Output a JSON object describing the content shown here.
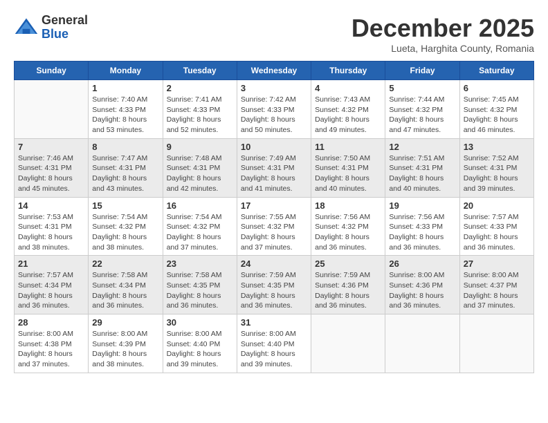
{
  "header": {
    "logo_general": "General",
    "logo_blue": "Blue",
    "month_title": "December 2025",
    "location": "Lueta, Harghita County, Romania"
  },
  "weekdays": [
    "Sunday",
    "Monday",
    "Tuesday",
    "Wednesday",
    "Thursday",
    "Friday",
    "Saturday"
  ],
  "weeks": [
    [
      {
        "day": "",
        "info": ""
      },
      {
        "day": "1",
        "info": "Sunrise: 7:40 AM\nSunset: 4:33 PM\nDaylight: 8 hours\nand 53 minutes."
      },
      {
        "day": "2",
        "info": "Sunrise: 7:41 AM\nSunset: 4:33 PM\nDaylight: 8 hours\nand 52 minutes."
      },
      {
        "day": "3",
        "info": "Sunrise: 7:42 AM\nSunset: 4:33 PM\nDaylight: 8 hours\nand 50 minutes."
      },
      {
        "day": "4",
        "info": "Sunrise: 7:43 AM\nSunset: 4:32 PM\nDaylight: 8 hours\nand 49 minutes."
      },
      {
        "day": "5",
        "info": "Sunrise: 7:44 AM\nSunset: 4:32 PM\nDaylight: 8 hours\nand 47 minutes."
      },
      {
        "day": "6",
        "info": "Sunrise: 7:45 AM\nSunset: 4:32 PM\nDaylight: 8 hours\nand 46 minutes."
      }
    ],
    [
      {
        "day": "7",
        "info": "Sunrise: 7:46 AM\nSunset: 4:31 PM\nDaylight: 8 hours\nand 45 minutes."
      },
      {
        "day": "8",
        "info": "Sunrise: 7:47 AM\nSunset: 4:31 PM\nDaylight: 8 hours\nand 43 minutes."
      },
      {
        "day": "9",
        "info": "Sunrise: 7:48 AM\nSunset: 4:31 PM\nDaylight: 8 hours\nand 42 minutes."
      },
      {
        "day": "10",
        "info": "Sunrise: 7:49 AM\nSunset: 4:31 PM\nDaylight: 8 hours\nand 41 minutes."
      },
      {
        "day": "11",
        "info": "Sunrise: 7:50 AM\nSunset: 4:31 PM\nDaylight: 8 hours\nand 40 minutes."
      },
      {
        "day": "12",
        "info": "Sunrise: 7:51 AM\nSunset: 4:31 PM\nDaylight: 8 hours\nand 40 minutes."
      },
      {
        "day": "13",
        "info": "Sunrise: 7:52 AM\nSunset: 4:31 PM\nDaylight: 8 hours\nand 39 minutes."
      }
    ],
    [
      {
        "day": "14",
        "info": "Sunrise: 7:53 AM\nSunset: 4:31 PM\nDaylight: 8 hours\nand 38 minutes."
      },
      {
        "day": "15",
        "info": "Sunrise: 7:54 AM\nSunset: 4:32 PM\nDaylight: 8 hours\nand 38 minutes."
      },
      {
        "day": "16",
        "info": "Sunrise: 7:54 AM\nSunset: 4:32 PM\nDaylight: 8 hours\nand 37 minutes."
      },
      {
        "day": "17",
        "info": "Sunrise: 7:55 AM\nSunset: 4:32 PM\nDaylight: 8 hours\nand 37 minutes."
      },
      {
        "day": "18",
        "info": "Sunrise: 7:56 AM\nSunset: 4:32 PM\nDaylight: 8 hours\nand 36 minutes."
      },
      {
        "day": "19",
        "info": "Sunrise: 7:56 AM\nSunset: 4:33 PM\nDaylight: 8 hours\nand 36 minutes."
      },
      {
        "day": "20",
        "info": "Sunrise: 7:57 AM\nSunset: 4:33 PM\nDaylight: 8 hours\nand 36 minutes."
      }
    ],
    [
      {
        "day": "21",
        "info": "Sunrise: 7:57 AM\nSunset: 4:34 PM\nDaylight: 8 hours\nand 36 minutes."
      },
      {
        "day": "22",
        "info": "Sunrise: 7:58 AM\nSunset: 4:34 PM\nDaylight: 8 hours\nand 36 minutes."
      },
      {
        "day": "23",
        "info": "Sunrise: 7:58 AM\nSunset: 4:35 PM\nDaylight: 8 hours\nand 36 minutes."
      },
      {
        "day": "24",
        "info": "Sunrise: 7:59 AM\nSunset: 4:35 PM\nDaylight: 8 hours\nand 36 minutes."
      },
      {
        "day": "25",
        "info": "Sunrise: 7:59 AM\nSunset: 4:36 PM\nDaylight: 8 hours\nand 36 minutes."
      },
      {
        "day": "26",
        "info": "Sunrise: 8:00 AM\nSunset: 4:36 PM\nDaylight: 8 hours\nand 36 minutes."
      },
      {
        "day": "27",
        "info": "Sunrise: 8:00 AM\nSunset: 4:37 PM\nDaylight: 8 hours\nand 37 minutes."
      }
    ],
    [
      {
        "day": "28",
        "info": "Sunrise: 8:00 AM\nSunset: 4:38 PM\nDaylight: 8 hours\nand 37 minutes."
      },
      {
        "day": "29",
        "info": "Sunrise: 8:00 AM\nSunset: 4:39 PM\nDaylight: 8 hours\nand 38 minutes."
      },
      {
        "day": "30",
        "info": "Sunrise: 8:00 AM\nSunset: 4:40 PM\nDaylight: 8 hours\nand 39 minutes."
      },
      {
        "day": "31",
        "info": "Sunrise: 8:00 AM\nSunset: 4:40 PM\nDaylight: 8 hours\nand 39 minutes."
      },
      {
        "day": "",
        "info": ""
      },
      {
        "day": "",
        "info": ""
      },
      {
        "day": "",
        "info": ""
      }
    ]
  ]
}
